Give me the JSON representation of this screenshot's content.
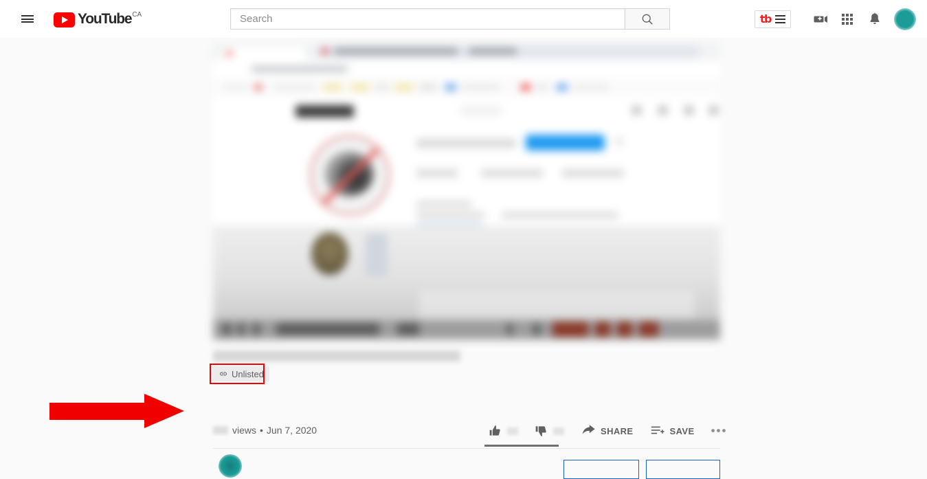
{
  "header": {
    "menu_icon": "hamburger-menu-icon",
    "logo_text": "YouTube",
    "logo_country": "CA",
    "search": {
      "placeholder": "Search",
      "value": "",
      "button_icon": "search-icon"
    },
    "extension": {
      "name": "tb",
      "icon": "tubebuddy-icon",
      "menu_icon": "hamburger-menu-icon"
    },
    "icons": [
      {
        "name": "create-video-icon",
        "label": "Create"
      },
      {
        "name": "apps-grid-icon",
        "label": "YouTube apps"
      },
      {
        "name": "notifications-bell-icon",
        "label": "Notifications"
      }
    ],
    "avatar": {
      "name": "account-avatar",
      "color": "#1b9c98"
    }
  },
  "video": {
    "player_label": "video-player",
    "title": "",
    "privacy_badge": {
      "icon": "link-icon",
      "label": "Unlisted"
    },
    "views_label": "views",
    "separator": "•",
    "published_date": "Jun 7, 2020",
    "actions": [
      {
        "name": "like-button",
        "icon": "thumbs-up-icon",
        "label": ""
      },
      {
        "name": "dislike-button",
        "icon": "thumbs-down-icon",
        "label": ""
      },
      {
        "name": "share-button",
        "icon": "share-arrow-icon",
        "label": "SHARE"
      },
      {
        "name": "save-button",
        "icon": "save-playlist-icon",
        "label": "SAVE"
      },
      {
        "name": "more-actions-button",
        "icon": "more-horizontal-icon",
        "label": ""
      }
    ],
    "more_glyph": "•••"
  },
  "annotation": {
    "arrow": {
      "name": "red-arrow-annotation",
      "color": "#f10000",
      "points_to": "Unlisted"
    },
    "highlight_box": {
      "name": "red-highlight-box",
      "color": "#ee0000",
      "target": "Unlisted"
    }
  },
  "colors": {
    "brand_red": "#ff0000",
    "annotation_red": "#f10000",
    "text_primary": "#030303",
    "text_secondary": "#606060",
    "page_bg": "#fafafa",
    "avatar_teal": "#1b9c98",
    "button_blue": "#1565c0"
  }
}
